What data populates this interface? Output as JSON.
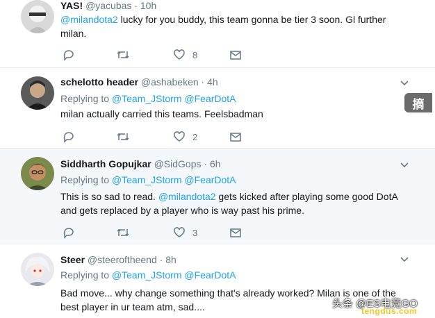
{
  "tweets": [
    {
      "name": "YAS!",
      "handle": "@yacubas",
      "time": "10h",
      "mention": "@milandota2",
      "text_line1": " lucky for you buddy, this team gonna be tier 3 soon. Gl further",
      "text_line2": "milan.",
      "replies": "",
      "retweets": "",
      "likes": "8"
    },
    {
      "name": "schelotto header",
      "handle": "@ashabeken",
      "time": "4h",
      "replying_to": "Replying to",
      "reply_handles": "@Team_JStorm @FearDotA",
      "text_line1": "milan actually carried this teams. Feelsbadman",
      "likes": "2"
    },
    {
      "name": "Siddharth Gopujkar",
      "handle": "@SidGops",
      "time": "6h",
      "replying_to": "Replying to",
      "reply_handles": "@Team_JStorm @FearDotA",
      "text_pre": "This is so sad to read. ",
      "mention": "@milandota2",
      "text_post": " gets kicked after playing some good DotA",
      "text_line2": "and gets replaced by a player who is way past his prime.",
      "likes": "3"
    },
    {
      "name": "Steer",
      "handle": "@steeroftheend",
      "time": "8h",
      "replying_to": "Replying to",
      "reply_handles": "@Team_JStorm @FearDotA",
      "text_line1": "Bad move... why change something that's already worked? Milan is one of the",
      "text_line2": "best player in ur team atm, sad...."
    }
  ],
  "separator": "·",
  "overlay": {
    "badge": "摘",
    "watermark_line1": "头条 @ES电竞GO",
    "watermark_line2": "tengdus.com"
  },
  "colors": {
    "link": "#1da1f2",
    "secondary": "#657786",
    "highlight_bg": "#f5f8fa"
  },
  "icons": [
    "reply-icon",
    "retweet-icon",
    "like-icon",
    "message-icon",
    "chevron-down-icon"
  ]
}
